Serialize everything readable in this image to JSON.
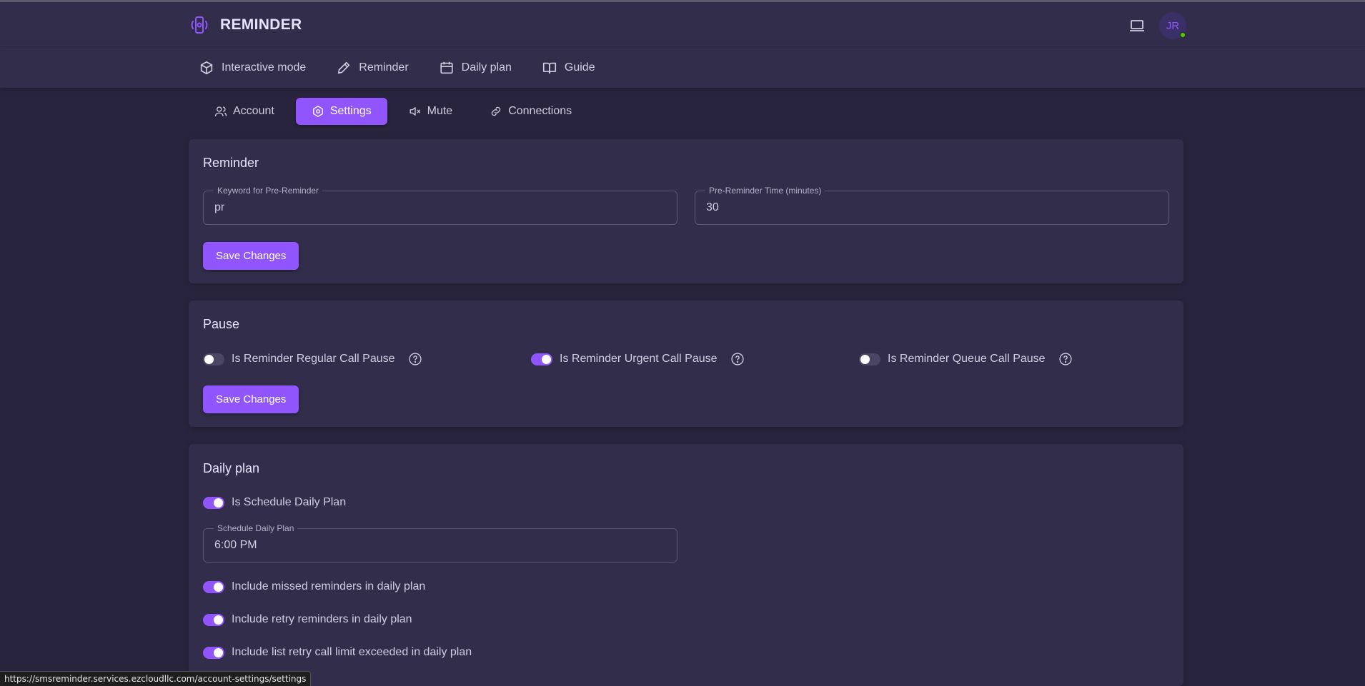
{
  "app": {
    "name": "REMINDER",
    "avatar_initials": "JR"
  },
  "nav": [
    {
      "label": "Interactive mode",
      "icon": "cube-icon"
    },
    {
      "label": "Reminder",
      "icon": "pencil-icon"
    },
    {
      "label": "Daily plan",
      "icon": "calendar-icon"
    },
    {
      "label": "Guide",
      "icon": "book-icon"
    }
  ],
  "tabs": [
    {
      "label": "Account",
      "icon": "user-icon",
      "active": false
    },
    {
      "label": "Settings",
      "icon": "settings-icon",
      "active": true
    },
    {
      "label": "Mute",
      "icon": "mute-icon",
      "active": false
    },
    {
      "label": "Connections",
      "icon": "link-icon",
      "active": false
    }
  ],
  "reminder": {
    "title": "Reminder",
    "keyword_label": "Keyword for Pre-Reminder",
    "keyword_value": "pr",
    "time_label": "Pre-Reminder Time (minutes)",
    "time_value": "30",
    "save_label": "Save Changes"
  },
  "pause": {
    "title": "Pause",
    "regular": {
      "label": "Is Reminder Regular Call Pause",
      "on": false
    },
    "urgent": {
      "label": "Is Reminder Urgent Call Pause",
      "on": true
    },
    "queue": {
      "label": "Is Reminder Queue Call Pause",
      "on": false
    },
    "save_label": "Save Changes"
  },
  "daily_plan": {
    "title": "Daily plan",
    "schedule_toggle": {
      "label": "Is Schedule Daily Plan",
      "on": true
    },
    "schedule_field_label": "Schedule Daily Plan",
    "schedule_field_value": "6:00 PM",
    "missed": {
      "label": "Include missed reminders in daily plan",
      "on": true
    },
    "retry": {
      "label": "Include retry reminders in daily plan",
      "on": true
    },
    "limit": {
      "label": "Include list retry call limit exceeded in daily plan",
      "on": true
    }
  },
  "status_url": "https://smsreminder.services.ezcloudllc.com/account-settings/settings",
  "colors": {
    "accent": "#9155fd",
    "background": "#28243d",
    "surface": "#312d4b",
    "online": "#56ca00"
  }
}
